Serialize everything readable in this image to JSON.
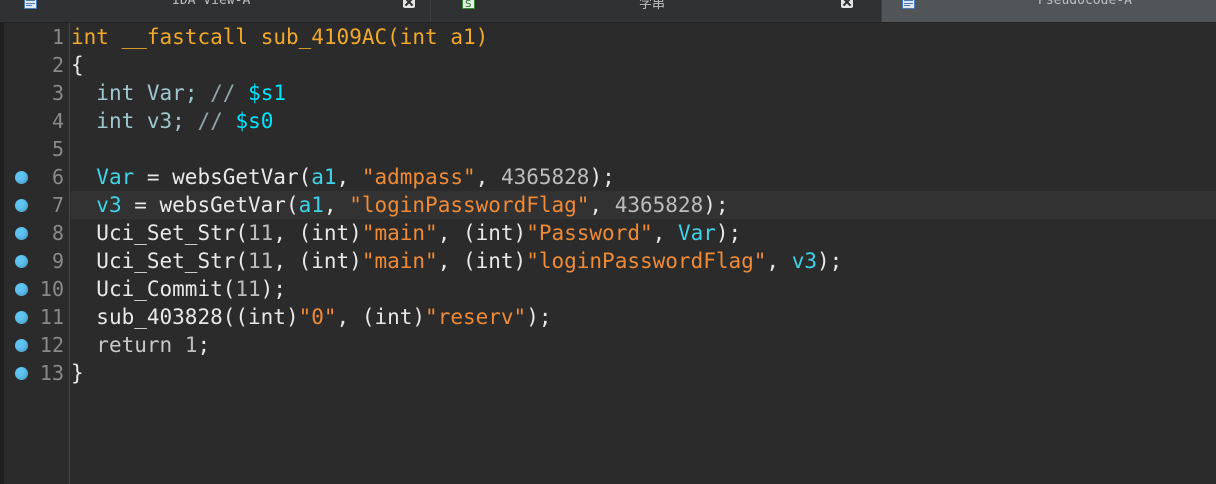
{
  "tabs": [
    {
      "label": "IDA View-A",
      "icon": "ida-view-icon",
      "closable": true,
      "active": false
    },
    {
      "label": "字串",
      "icon": "strings-icon",
      "closable": true,
      "active": false
    },
    {
      "label": "Pseudocode-A",
      "icon": "pseudocode-icon",
      "closable": false,
      "active": true
    }
  ],
  "editor": {
    "line_numbers": [
      "1",
      "2",
      "3",
      "4",
      "5",
      "6",
      "7",
      "8",
      "9",
      "10",
      "11",
      "12",
      "13"
    ],
    "breakpoint_lines": [
      6,
      7,
      8,
      9,
      10,
      11,
      12,
      13
    ],
    "current_line": 7,
    "code": {
      "l1_type": "int",
      "l1_conv": "__fastcall",
      "l1_name": "sub_4109AC(",
      "l1_ptype": "int",
      "l1_param": "a1)",
      "l2": "{",
      "l3_type": "int",
      "l3_var": "Var;",
      "l3_cmt": "//",
      "l3_reg": "$s1",
      "l4_type": "int",
      "l4_var": "v3;",
      "l4_cmt": "//",
      "l4_reg": "$s0",
      "l6_var": "Var",
      "l6_eq": " = websGetVar(",
      "l6_arg": "a1",
      "l6_sep": ", ",
      "l6_str": "\"admpass\"",
      "l6_num": "4365828",
      "l6_end": ");",
      "l7_var": "v3",
      "l7_eq": " = websGetVar(",
      "l7_arg": "a1",
      "l7_sep": ", ",
      "l7_str": "\"loginPasswordFlag\"",
      "l7_num": "4365828",
      "l7_end": ");",
      "l8_fn": "Uci_Set_Str(",
      "l8_num": "11",
      "l8_c1": "(int)",
      "l8_s1": "\"main\"",
      "l8_c2": "(int)",
      "l8_s2": "\"Password\"",
      "l8_var": "Var",
      "l8_end": ");",
      "l9_fn": "Uci_Set_Str(",
      "l9_num": "11",
      "l9_c1": "(int)",
      "l9_s1": "\"main\"",
      "l9_c2": "(int)",
      "l9_s2": "\"loginPasswordFlag\"",
      "l9_var": "v3",
      "l9_end": ");",
      "l10_fn": "Uci_Commit(",
      "l10_num": "11",
      "l10_end": ");",
      "l11_fn": "sub_403828(",
      "l11_c1": "(int)",
      "l11_s1": "\"0\"",
      "l11_c2": "(int)",
      "l11_s2": "\"reserv\"",
      "l11_end": ");",
      "l12_kw": "return",
      "l12_num": "1",
      "l12_end": ";",
      "l13": "}"
    }
  },
  "colors": {
    "background": "#2b2b2b",
    "keyword": "#f0a92a",
    "variable": "#3fd3e9",
    "string": "#ef8a36",
    "register": "#00e5ff",
    "breakpoint": "#5fc4f2"
  }
}
